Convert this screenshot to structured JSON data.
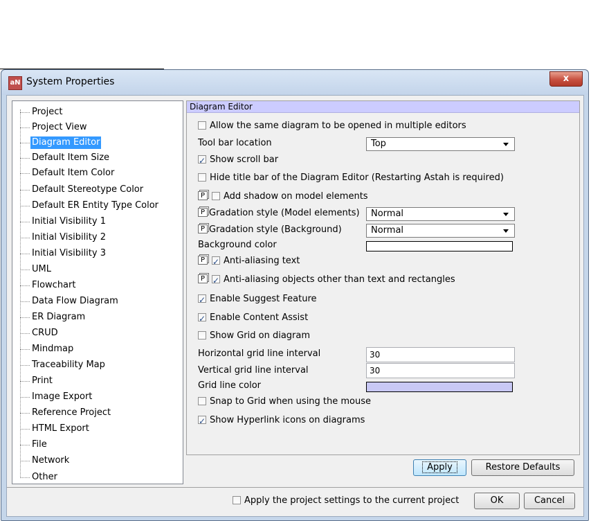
{
  "window": {
    "title": "System Properties",
    "app_icon": "aN",
    "close_icon": "x"
  },
  "sidebar": {
    "items": [
      {
        "label": "Project"
      },
      {
        "label": "Project View"
      },
      {
        "label": "Diagram Editor",
        "selected": true
      },
      {
        "label": "Default Item Size"
      },
      {
        "label": "Default Item Color"
      },
      {
        "label": "Default Stereotype Color"
      },
      {
        "label": "Default ER Entity Type Color"
      },
      {
        "label": "Initial Visibility 1"
      },
      {
        "label": "Initial Visibility 2"
      },
      {
        "label": "Initial Visibility 3"
      },
      {
        "label": "UML"
      },
      {
        "label": "Flowchart"
      },
      {
        "label": "Data Flow Diagram"
      },
      {
        "label": "ER Diagram"
      },
      {
        "label": "CRUD"
      },
      {
        "label": "Mindmap"
      },
      {
        "label": "Traceability Map"
      },
      {
        "label": "Print"
      },
      {
        "label": "Image Export"
      },
      {
        "label": "Reference Project"
      },
      {
        "label": "HTML Export"
      },
      {
        "label": "File"
      },
      {
        "label": "Network"
      },
      {
        "label": "Other"
      }
    ]
  },
  "panel": {
    "title": "Diagram Editor",
    "p_icon": "P",
    "allow_same_diagram": {
      "label": "Allow the same diagram to be opened in multiple editors",
      "checked": false
    },
    "toolbar_location": {
      "label": "Tool bar location",
      "value": "Top"
    },
    "show_scroll_bar": {
      "label": "Show scroll bar",
      "checked": true
    },
    "hide_title_bar": {
      "label": "Hide title bar of the Diagram Editor (Restarting Astah is required)",
      "checked": false
    },
    "add_shadow": {
      "label": "Add shadow on model elements",
      "checked": false
    },
    "gradation_model": {
      "label": "Gradation style (Model elements)",
      "value": "Normal"
    },
    "gradation_background": {
      "label": "Gradation style (Background)",
      "value": "Normal"
    },
    "background_color": {
      "label": "Background color",
      "color": "#ffffff"
    },
    "anti_alias_text": {
      "label": "Anti-aliasing text",
      "checked": true
    },
    "anti_alias_objects": {
      "label": "Anti-aliasing objects other than text and rectangles",
      "checked": true
    },
    "suggest_feature": {
      "label": "Enable Suggest Feature",
      "checked": true
    },
    "content_assist": {
      "label": "Enable Content Assist",
      "checked": true
    },
    "show_grid": {
      "label": "Show Grid on diagram",
      "checked": false
    },
    "h_grid_interval": {
      "label": "Horizontal grid line interval",
      "value": "30"
    },
    "v_grid_interval": {
      "label": "Vertical grid line interval",
      "value": "30"
    },
    "grid_line_color": {
      "label": "Grid line color",
      "color": "#c8c8f5"
    },
    "snap_to_grid": {
      "label": "Snap to Grid when using the mouse",
      "checked": false
    },
    "show_hyperlink_icons": {
      "label": "Show Hyperlink icons on diagrams",
      "checked": true
    }
  },
  "buttons": {
    "apply": "Apply",
    "restore_defaults": "Restore Defaults",
    "ok": "OK",
    "cancel": "Cancel"
  },
  "footer": {
    "apply_project_settings": {
      "label": "Apply the project settings to the current project",
      "checked": false
    }
  }
}
